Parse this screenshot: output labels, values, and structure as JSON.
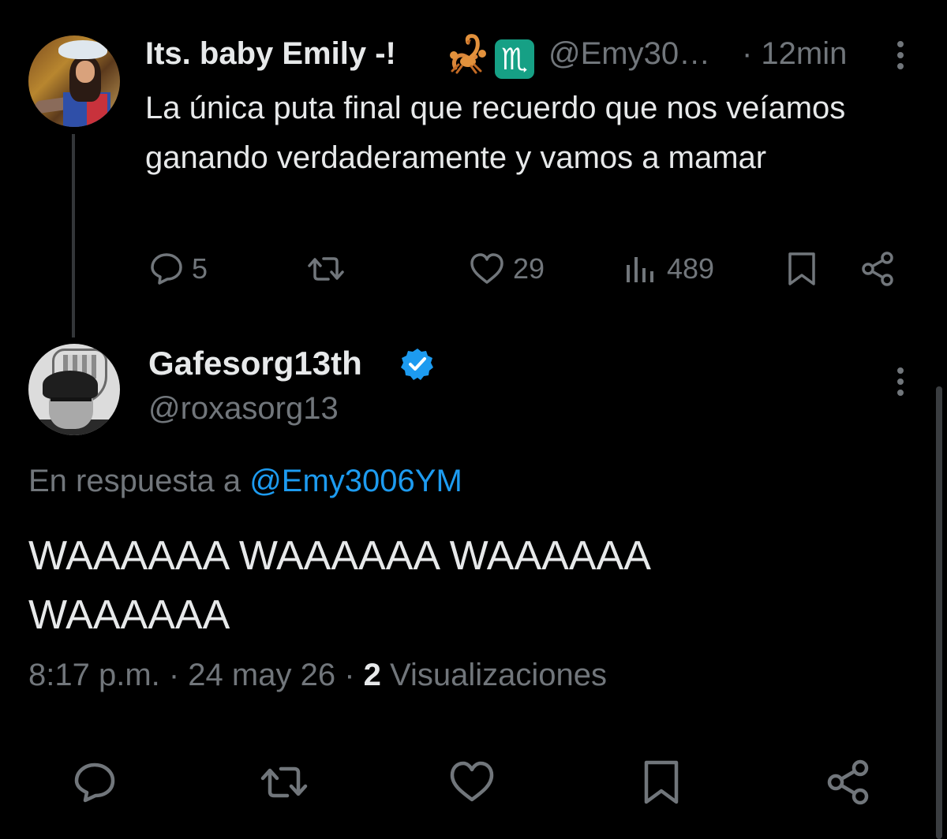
{
  "parent_tweet": {
    "author_name": "Its. baby Emily -!",
    "emoji_1": "scorpion-emoji",
    "emoji_2_glyph": "♏",
    "handle": "@Emy30…",
    "time": "· 12min",
    "text": "La única puta final que recuerdo que nos veíamos ganando verdaderamente y vamos a mamar",
    "actions": {
      "replies": "5",
      "likes": "29",
      "views": "489"
    }
  },
  "reply_tweet": {
    "author_name": "Gafesorg13th",
    "verified": true,
    "handle": "@roxasorg13",
    "reply_prefix": "En respuesta a ",
    "reply_mention": "@Emy3006YM",
    "text": "WAAAAAA WAAAAAA WAAAAAA WAAAAAA",
    "timestamp": "8:17 p.m. · 24 may 26 · ",
    "views_count": "2",
    "views_label": " Visualizaciones"
  },
  "colors": {
    "background": "#000000",
    "primary_text": "#e7e9ea",
    "secondary_text": "#71767b",
    "accent": "#1d9bf0"
  }
}
